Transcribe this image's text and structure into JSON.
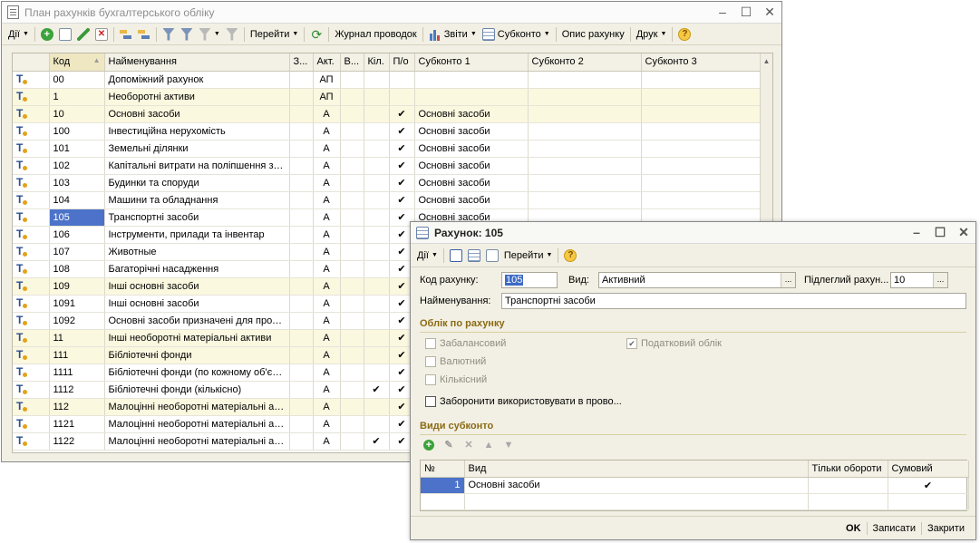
{
  "main_window": {
    "title": "План рахунків бухгалтерського обліку",
    "toolbar": {
      "actions_label": "Дії",
      "goto_label": "Перейти",
      "journal_label": "Журнал проводок",
      "reports_label": "Звіти",
      "subconto_label": "Субконто",
      "account_desc_label": "Опис рахунку",
      "print_label": "Друк"
    },
    "columns": [
      "Код",
      "Найменування",
      "З...",
      "Акт.",
      "В...",
      "Кіл.",
      "П/о",
      "Субконто 1",
      "Субконто 2",
      "Субконто 3"
    ],
    "rows": [
      {
        "code": "00",
        "name": "Допоміжний рахунок",
        "z": "",
        "akt": "АП",
        "v": "",
        "kil": "",
        "po": "",
        "s1": "",
        "s2": "",
        "s3": "",
        "highlight": false
      },
      {
        "code": "1",
        "name": "Необоротні активи",
        "z": "",
        "akt": "АП",
        "v": "",
        "kil": "",
        "po": "",
        "s1": "",
        "s2": "",
        "s3": "",
        "highlight": true
      },
      {
        "code": "10",
        "name": "Основні засоби",
        "z": "",
        "akt": "А",
        "v": "",
        "kil": "",
        "po": "✔",
        "s1": "Основні засоби",
        "s2": "",
        "s3": "",
        "highlight": true
      },
      {
        "code": "100",
        "name": "Інвестиційна нерухомість",
        "z": "",
        "akt": "А",
        "v": "",
        "kil": "",
        "po": "✔",
        "s1": "Основні засоби",
        "s2": "",
        "s3": "",
        "highlight": false
      },
      {
        "code": "101",
        "name": "Земельні ділянки",
        "z": "",
        "akt": "А",
        "v": "",
        "kil": "",
        "po": "✔",
        "s1": "Основні засоби",
        "s2": "",
        "s3": "",
        "highlight": false
      },
      {
        "code": "102",
        "name": "Капітальні витрати на поліпшення зе...",
        "z": "",
        "akt": "А",
        "v": "",
        "kil": "",
        "po": "✔",
        "s1": "Основні засоби",
        "s2": "",
        "s3": "",
        "highlight": false
      },
      {
        "code": "103",
        "name": "Будинки та споруди",
        "z": "",
        "akt": "А",
        "v": "",
        "kil": "",
        "po": "✔",
        "s1": "Основні засоби",
        "s2": "",
        "s3": "",
        "highlight": false
      },
      {
        "code": "104",
        "name": "Машини та обладнання",
        "z": "",
        "akt": "А",
        "v": "",
        "kil": "",
        "po": "✔",
        "s1": "Основні засоби",
        "s2": "",
        "s3": "",
        "highlight": false
      },
      {
        "code": "105",
        "name": "Транспортні засоби",
        "z": "",
        "akt": "А",
        "v": "",
        "kil": "",
        "po": "✔",
        "s1": "Основні засоби",
        "s2": "",
        "s3": "",
        "highlight": false,
        "selected": true
      },
      {
        "code": "106",
        "name": "Інструменти, прилади та інвентар",
        "z": "",
        "akt": "А",
        "v": "",
        "kil": "",
        "po": "✔",
        "s1": "",
        "s2": "",
        "s3": "",
        "highlight": false
      },
      {
        "code": "107",
        "name": "Животные",
        "z": "",
        "akt": "А",
        "v": "",
        "kil": "",
        "po": "✔",
        "s1": "",
        "s2": "",
        "s3": "",
        "highlight": false
      },
      {
        "code": "108",
        "name": "Багаторічні насадження",
        "z": "",
        "akt": "А",
        "v": "",
        "kil": "",
        "po": "✔",
        "s1": "",
        "s2": "",
        "s3": "",
        "highlight": false
      },
      {
        "code": "109",
        "name": "Інші основні засоби",
        "z": "",
        "akt": "А",
        "v": "",
        "kil": "",
        "po": "✔",
        "s1": "",
        "s2": "",
        "s3": "",
        "highlight": true
      },
      {
        "code": "1091",
        "name": "Інші основні засоби",
        "z": "",
        "akt": "А",
        "v": "",
        "kil": "",
        "po": "✔",
        "s1": "",
        "s2": "",
        "s3": "",
        "highlight": false
      },
      {
        "code": "1092",
        "name": "Основні засоби призначені для прод...",
        "z": "",
        "akt": "А",
        "v": "",
        "kil": "",
        "po": "✔",
        "s1": "",
        "s2": "",
        "s3": "",
        "highlight": false
      },
      {
        "code": "11",
        "name": "Інші необоротні матеріальні активи",
        "z": "",
        "akt": "А",
        "v": "",
        "kil": "",
        "po": "✔",
        "s1": "",
        "s2": "",
        "s3": "",
        "highlight": true
      },
      {
        "code": "111",
        "name": "Бібліотечні фонди",
        "z": "",
        "akt": "А",
        "v": "",
        "kil": "",
        "po": "✔",
        "s1": "",
        "s2": "",
        "s3": "",
        "highlight": true
      },
      {
        "code": "1111",
        "name": "Бібліотечні фонди (по кожному об'єкту)",
        "z": "",
        "akt": "А",
        "v": "",
        "kil": "",
        "po": "✔",
        "s1": "",
        "s2": "",
        "s3": "",
        "highlight": false
      },
      {
        "code": "1112",
        "name": "Бібліотечні фонди (кількісно)",
        "z": "",
        "akt": "А",
        "v": "",
        "kil": "✔",
        "po": "✔",
        "s1": "",
        "s2": "",
        "s3": "",
        "highlight": false
      },
      {
        "code": "112",
        "name": "Малоцінні необоротні матеріальні акт...",
        "z": "",
        "akt": "А",
        "v": "",
        "kil": "",
        "po": "✔",
        "s1": "",
        "s2": "",
        "s3": "",
        "highlight": true
      },
      {
        "code": "1121",
        "name": "Малоцінні необоротні матеріальні акт...",
        "z": "",
        "akt": "А",
        "v": "",
        "kil": "",
        "po": "✔",
        "s1": "",
        "s2": "",
        "s3": "",
        "highlight": false
      },
      {
        "code": "1122",
        "name": "Малоцінні необоротні матеріальні акт...",
        "z": "",
        "akt": "А",
        "v": "",
        "kil": "✔",
        "po": "✔",
        "s1": "",
        "s2": "",
        "s3": "",
        "highlight": false
      }
    ]
  },
  "dialog": {
    "title": "Рахунок: 105",
    "toolbar": {
      "actions_label": "Дії",
      "goto_label": "Перейти"
    },
    "code_label": "Код рахунку:",
    "code_value": "105",
    "type_label": "Вид:",
    "type_value": "Активний",
    "parent_label": "Підлеглий рахун...",
    "parent_value": "10",
    "name_label": "Найменування:",
    "name_value": "Транспортні засоби",
    "accounting_section": "Облік по рахунку",
    "offbalance_label": "Забалансовий",
    "currency_label": "Валютний",
    "quantity_label": "Кількісний",
    "tax_label": "Податковий облік",
    "prohibit_label": "Заборонити використовувати в прово...",
    "subconto_section": "Види субконто",
    "subconto_columns": [
      "№",
      "Вид",
      "Тільки обороти",
      "Сумовий"
    ],
    "subconto_rows": [
      {
        "num": "1",
        "kind": "Основні засоби",
        "turnover_only": "",
        "sum": "✔"
      }
    ],
    "ok_label": "OK",
    "save_label": "Записати",
    "close_label": "Закрити"
  }
}
